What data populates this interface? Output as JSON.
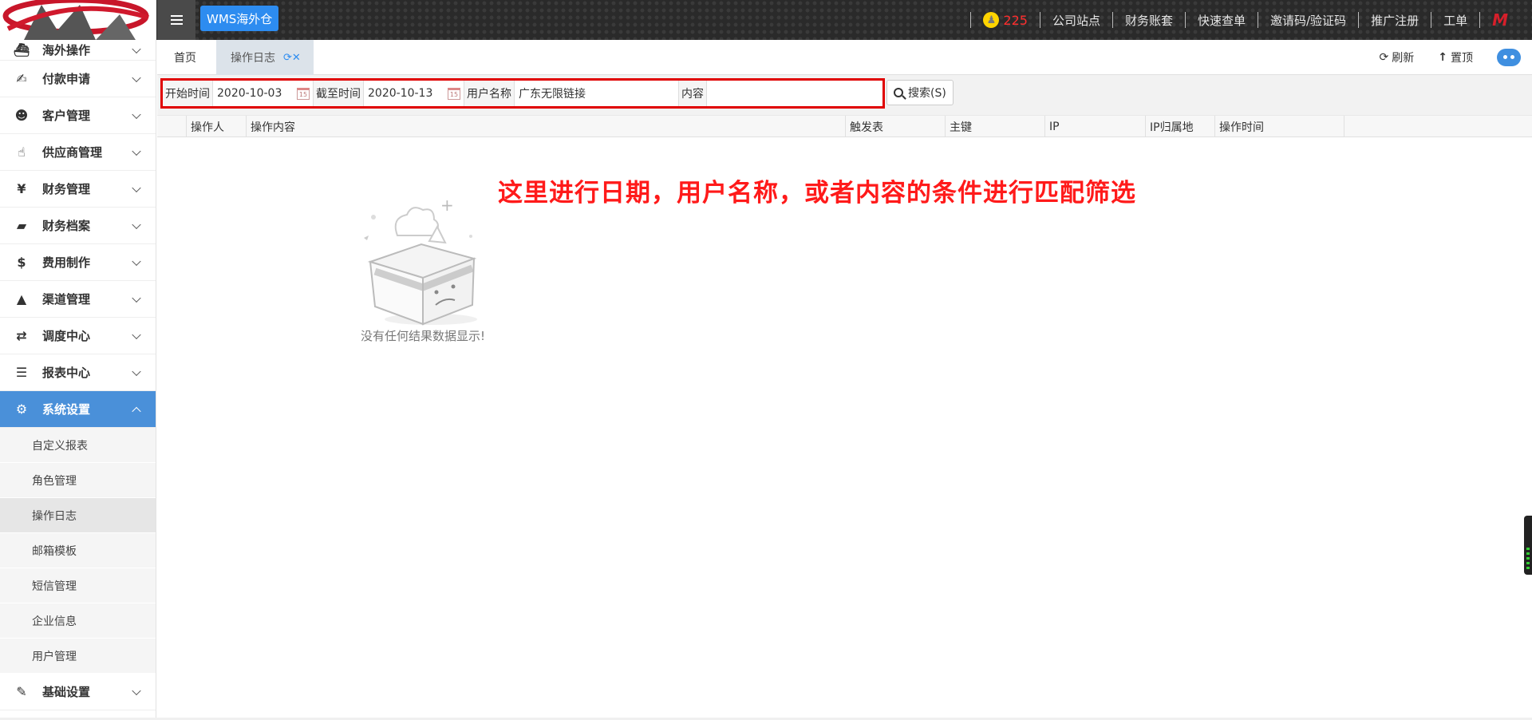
{
  "header": {
    "wms_label": "WMS海外仓",
    "notification_count": "225",
    "nav_links": [
      "公司站点",
      "财务账套",
      "快速查单",
      "邀请码/验证码",
      "推广注册",
      "工单"
    ]
  },
  "sidebar": {
    "items": [
      {
        "label": "海外操作",
        "icon": "ship-icon"
      },
      {
        "label": "付款申请",
        "icon": "hand-money-icon"
      },
      {
        "label": "客户管理",
        "icon": "users-icon"
      },
      {
        "label": "供应商管理",
        "icon": "thumbs-up-icon"
      },
      {
        "label": "财务管理",
        "icon": "yen-icon"
      },
      {
        "label": "财务档案",
        "icon": "book-icon"
      },
      {
        "label": "费用制作",
        "icon": "dollar-icon"
      },
      {
        "label": "渠道管理",
        "icon": "road-icon"
      },
      {
        "label": "调度中心",
        "icon": "retweet-icon"
      },
      {
        "label": "报表中心",
        "icon": "file-text-icon"
      },
      {
        "label": "系统设置",
        "icon": "gear-icon"
      }
    ],
    "sub_items": [
      "自定义报表",
      "角色管理",
      "操作日志",
      "邮箱模板",
      "短信管理",
      "企业信息",
      "用户管理"
    ],
    "bottom_item": {
      "label": "基础设置",
      "icon": "edit-icon"
    }
  },
  "tabs": {
    "home": "首页",
    "active": "操作日志",
    "refresh": "刷新",
    "to_top": "置顶"
  },
  "filters": {
    "start_label": "开始时间",
    "start_value": "2020-10-03",
    "end_label": "截至时间",
    "end_value": "2020-10-13",
    "user_label": "用户名称",
    "user_value": "广东无限链接",
    "content_label": "内容",
    "content_value": "",
    "search_button": "搜索(S)"
  },
  "table": {
    "columns": [
      "操作人",
      "操作内容",
      "触发表",
      "主键",
      "IP",
      "IP归属地",
      "操作时间"
    ],
    "rows": []
  },
  "empty_state": "没有任何结果数据显示!",
  "annotation": "这里进行日期，用户名称，或者内容的条件进行匹配筛选",
  "colors": {
    "accent": "#2d8cf0",
    "sidebar_active": "#4a90d9",
    "highlight_border": "#e00000",
    "annotation_text": "#ff1a1a",
    "notification": "#ff2d2d"
  }
}
